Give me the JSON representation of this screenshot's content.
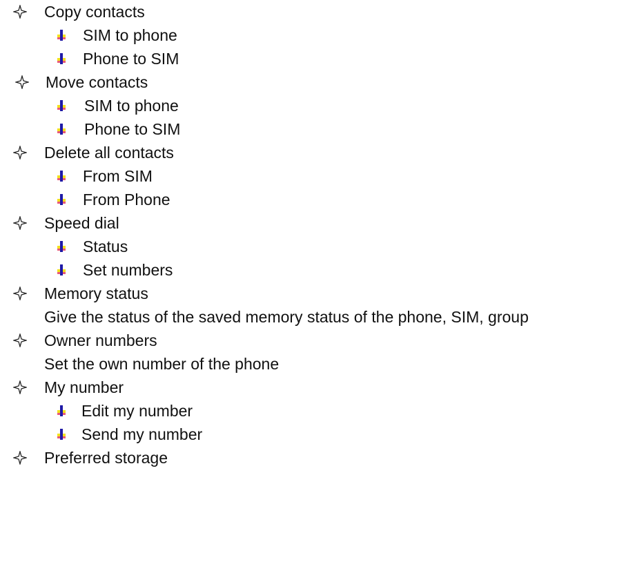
{
  "items": [
    {
      "label": "Copy contacts",
      "children": [
        "SIM to phone",
        "Phone to SIM"
      ]
    },
    {
      "label": "Move contacts",
      "children": [
        "SIM to phone",
        "Phone to SIM"
      ]
    },
    {
      "label": "Delete all contacts",
      "children": [
        "From SIM",
        "From Phone"
      ]
    },
    {
      "label": "Speed dial",
      "children": [
        "Status",
        "Set numbers"
      ]
    },
    {
      "label": "Memory status",
      "description": "Give the status of the saved memory status of the phone, SIM, group"
    },
    {
      "label": "Owner numbers",
      "description": "Set the own number of the phone"
    },
    {
      "label": "My number",
      "children": [
        "Edit my number",
        "Send my number"
      ]
    },
    {
      "label": "Preferred storage"
    }
  ],
  "colors": {
    "text": "#111111",
    "arrow_blue": "#1f1aa6",
    "arrow_yellow": "#f4e21c",
    "arrow_pink": "#e85a7a"
  },
  "icons": {
    "item_bullet": "four-point-star-icon",
    "sub_bullet": "down-arrow-icon"
  }
}
